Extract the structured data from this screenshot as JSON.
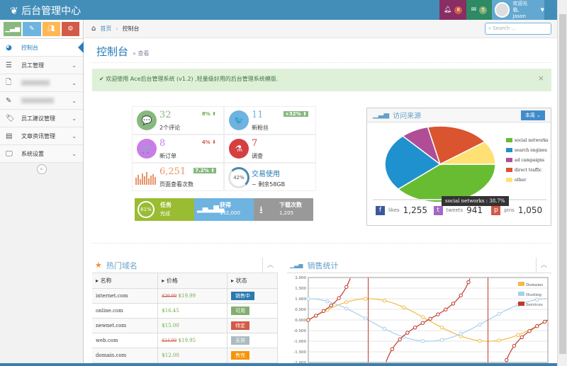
{
  "navbar": {
    "brand": "后台管理中心",
    "notifications": "8",
    "messages": "5",
    "welcome": "欢迎光临,",
    "user": "Jason"
  },
  "sidebar": {
    "items": [
      {
        "label": "控制台",
        "icon": "dashboard-icon"
      },
      {
        "label": "员工管理",
        "icon": "list-icon"
      },
      {
        "label": "",
        "icon": "file-icon"
      },
      {
        "label": "",
        "icon": "edit-icon"
      },
      {
        "label": "员工建议管理",
        "icon": "tag-icon"
      },
      {
        "label": "文章资讯管理",
        "icon": "calendar-icon"
      },
      {
        "label": "系统设置",
        "icon": "desktop-icon"
      }
    ]
  },
  "breadcrumb": {
    "home": "首页",
    "current": "控制台",
    "search_placeholder": "Search ..."
  },
  "page": {
    "title": "控制台",
    "subtitle": "» 查看"
  },
  "alert": {
    "text": "✔ 欢迎使用 Ace后台管理系统 (v1.2) ,轻量级好用的后台管理系统模版."
  },
  "infoboxes": [
    {
      "num": "32",
      "label": "2个评论",
      "stat": "8% ⬆",
      "color": "#87b87f",
      "icon": "comments-icon",
      "glyph": "💬"
    },
    {
      "num": "11",
      "label": "新粉丝",
      "stat": "+32% ⬆",
      "color": "#6fb3e0",
      "icon": "twitter-icon",
      "glyph": "🐦"
    },
    {
      "num": "8",
      "label": "新订单",
      "stat": "4% ⬇",
      "color": "#c97de6",
      "icon": "cart-icon",
      "glyph": "🛒"
    },
    {
      "num": "7",
      "label": "调查",
      "stat": "",
      "color": "#d53f40",
      "icon": "flask-icon",
      "glyph": "⚗"
    },
    {
      "num": "6,251",
      "label": "页面查看次数",
      "stat": "7.2% ⬆",
      "color": "#e8956b",
      "icon": "bar-sparkline-icon",
      "glyph": ""
    },
    {
      "num": "交易使用",
      "label": "~ 剩余58GB",
      "stat": "",
      "color": "#4b89aa",
      "icon": "progress-ring-icon",
      "glyph": "42%"
    }
  ],
  "tiles": [
    {
      "t1": "任务",
      "t2": "完成",
      "pct": "61%"
    },
    {
      "t1": "获得",
      "t2": "$32,000"
    },
    {
      "t1": "下载次数",
      "t2": "1,205"
    }
  ],
  "visitors": {
    "title": "访问来源",
    "range": "本周",
    "tooltip": "social networks : 38.7%",
    "social": [
      {
        "label": "likes",
        "value": "1,255"
      },
      {
        "label": "tweets",
        "value": "941"
      },
      {
        "label": "pins",
        "value": "1,050"
      }
    ]
  },
  "chart_data": [
    {
      "type": "pie",
      "title": "访问来源",
      "categories": [
        "social networks",
        "search engines",
        "ad campaigns",
        "direct traffic",
        "other"
      ],
      "values": [
        38.7,
        24.5,
        8.2,
        18.6,
        10
      ],
      "colors": [
        "#68bc31",
        "#2091cf",
        "#af4e96",
        "#da5430",
        "#fee074"
      ],
      "legend": "right"
    },
    {
      "type": "line",
      "title": "销售统计",
      "series": [
        {
          "name": "Domains",
          "fn": "sin",
          "step": 0.5,
          "color": "#f2bb46"
        },
        {
          "name": "Hosting",
          "fn": "cos",
          "step": 0.5,
          "color": "#a8cfec"
        },
        {
          "name": "Services",
          "fn": "tan",
          "step": 0.2,
          "color": "#c0392b"
        }
      ],
      "xlim": [
        0,
        6.283
      ],
      "ylim": [
        -2,
        2
      ],
      "yticks": [
        "2.000",
        "1.500",
        "1.000",
        "0.500",
        "0.000",
        "-0.500",
        "-1.000",
        "-1.500",
        "-2.000"
      ],
      "legend": "top-right",
      "grid": true
    }
  ],
  "domains": {
    "title": "热门域名",
    "headers": [
      "名称",
      "价格",
      "状态"
    ],
    "rows": [
      {
        "name": "internet.com",
        "old": "$29.99",
        "price": "$19.99",
        "status": "销售中",
        "color": "#2a7ab0"
      },
      {
        "name": "online.com",
        "old": "",
        "price": "$16.45",
        "status": "可用",
        "color": "#82af6f"
      },
      {
        "name": "newnet.com",
        "old": "",
        "price": "$15.00",
        "status": "待定",
        "color": "#d15b47"
      },
      {
        "name": "web.com",
        "old": "$24.99",
        "price": "$19.95",
        "status": "无货",
        "color": "#abbac3"
      },
      {
        "name": "domain.com",
        "old": "",
        "price": "$12.00",
        "status": "售完",
        "color": "#f89406"
      }
    ]
  },
  "sales": {
    "title": "销售统计"
  }
}
